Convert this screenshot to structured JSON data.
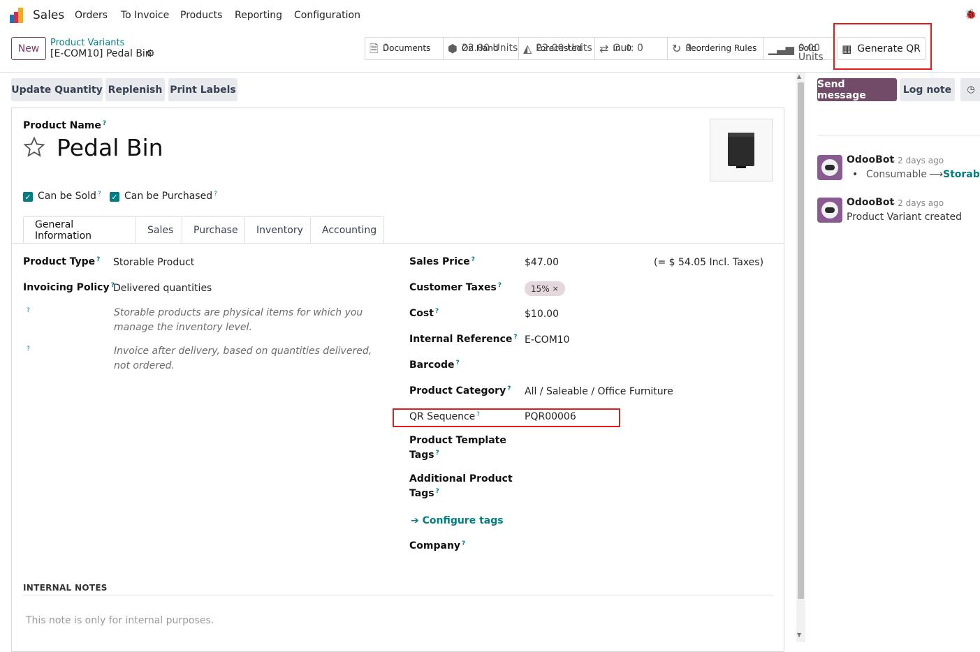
{
  "nav": {
    "app_name": "Sales",
    "menu": [
      "Orders",
      "To Invoice",
      "Products",
      "Reporting",
      "Configuration"
    ]
  },
  "control": {
    "new_label": "New",
    "breadcrumb_parent": "Product Variants",
    "breadcrumb_current": "[E-COM10] Pedal Bin"
  },
  "stats": [
    {
      "label": "Documents",
      "value": "0",
      "icon": "document-icon"
    },
    {
      "label": "On Hand",
      "value": "22.00 Units",
      "icon": "cubes-icon"
    },
    {
      "label": "Forecasted",
      "value": "22.00 Units",
      "icon": "area-chart-icon"
    },
    {
      "label": "In: 0",
      "value": "Out: 0",
      "icon": "exchange-icon"
    },
    {
      "label": "Reordering Rules",
      "value": "0",
      "icon": "refresh-icon"
    },
    {
      "label": "Sold",
      "value": "0.00 Units",
      "icon": "signal-icon"
    }
  ],
  "generate_qr_label": "Generate QR",
  "actions": [
    "Update Quantity",
    "Replenish",
    "Print Labels"
  ],
  "form": {
    "product_name_label": "Product Name",
    "product_name": "Pedal Bin",
    "can_be_sold": "Can be Sold",
    "can_be_purchased": "Can be Purchased",
    "tabs": [
      "General Information",
      "Sales",
      "Purchase",
      "Inventory",
      "Accounting"
    ],
    "left": {
      "product_type_label": "Product Type",
      "product_type": "Storable Product",
      "invoicing_policy_label": "Invoicing Policy",
      "invoicing_policy": "Delivered quantities",
      "help1": "Storable products are physical items for which you manage the inventory level.",
      "help2": "Invoice after delivery, based on quantities delivered, not ordered."
    },
    "right": {
      "sales_price_label": "Sales Price",
      "sales_price": "$47.00",
      "incl_taxes": "(= $ 54.05 Incl. Taxes)",
      "customer_taxes_label": "Customer Taxes",
      "customer_tax_tag": "15%",
      "cost_label": "Cost",
      "cost": "$10.00",
      "internal_ref_label": "Internal Reference",
      "internal_ref": "E-COM10",
      "barcode_label": "Barcode",
      "category_label": "Product Category",
      "category": "All / Saleable / Office Furniture",
      "qr_label": "QR Sequence",
      "qr_value": "PQR00006",
      "template_tags_label_1": "Product Template",
      "template_tags_label_2": "Tags",
      "additional_tags_label_1": "Additional Product",
      "additional_tags_label_2": "Tags",
      "configure_tags": "Configure tags",
      "company_label": "Company"
    },
    "internal_notes_title": "INTERNAL NOTES",
    "internal_notes_placeholder": "This note is only for internal purposes."
  },
  "chatter": {
    "send_message": "Send message",
    "log_note": "Log note",
    "messages": [
      {
        "author": "OdooBot",
        "time": "- 2 days ago",
        "old_value": "Consumable",
        "new_value": "Storable"
      },
      {
        "author": "OdooBot",
        "time": "- 2 days ago",
        "body": "Product Variant created"
      }
    ]
  },
  "colors": {
    "primary": "#714b67",
    "teal": "#017e84",
    "highlight": "#e21c1c"
  }
}
